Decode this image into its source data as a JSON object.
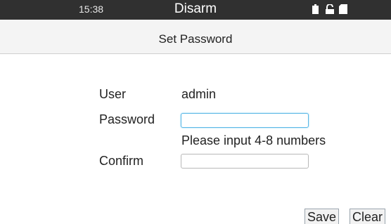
{
  "status_bar": {
    "time": "15:38",
    "mode": "Disarm",
    "icons": [
      "battery-icon",
      "unlock-icon",
      "sd-card-icon"
    ]
  },
  "header": {
    "title": "Set Password"
  },
  "form": {
    "user_label": "User",
    "user_value": "admin",
    "password_label": "Password",
    "password_value": "",
    "password_hint": "Please input 4-8 numbers",
    "confirm_label": "Confirm",
    "confirm_value": ""
  },
  "buttons": {
    "save": "Save",
    "clear": "Clear"
  },
  "colors": {
    "status_bar_bg": "#303030",
    "focus_border": "#5bb8e6",
    "header_bg": "#f4f4f4"
  }
}
